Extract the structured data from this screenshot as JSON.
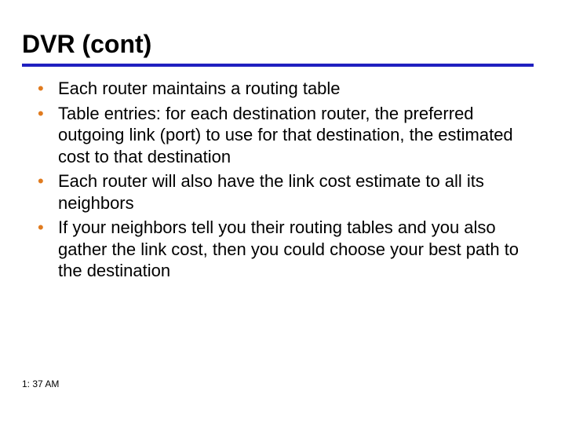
{
  "title": "DVR (cont)",
  "bullets": [
    "Each router maintains a routing table",
    "Table entries: for each destination router, the preferred outgoing link (port) to use for that destination, the estimated cost to that destination",
    "Each router will also have the link cost estimate to all its neighbors",
    " If your neighbors tell you their routing tables and you also gather the link cost, then you could choose your best path to the destination"
  ],
  "footer_time": "1: 37 AM",
  "colors": {
    "rule": "#2020c0",
    "bullet": "#e07b1f"
  }
}
